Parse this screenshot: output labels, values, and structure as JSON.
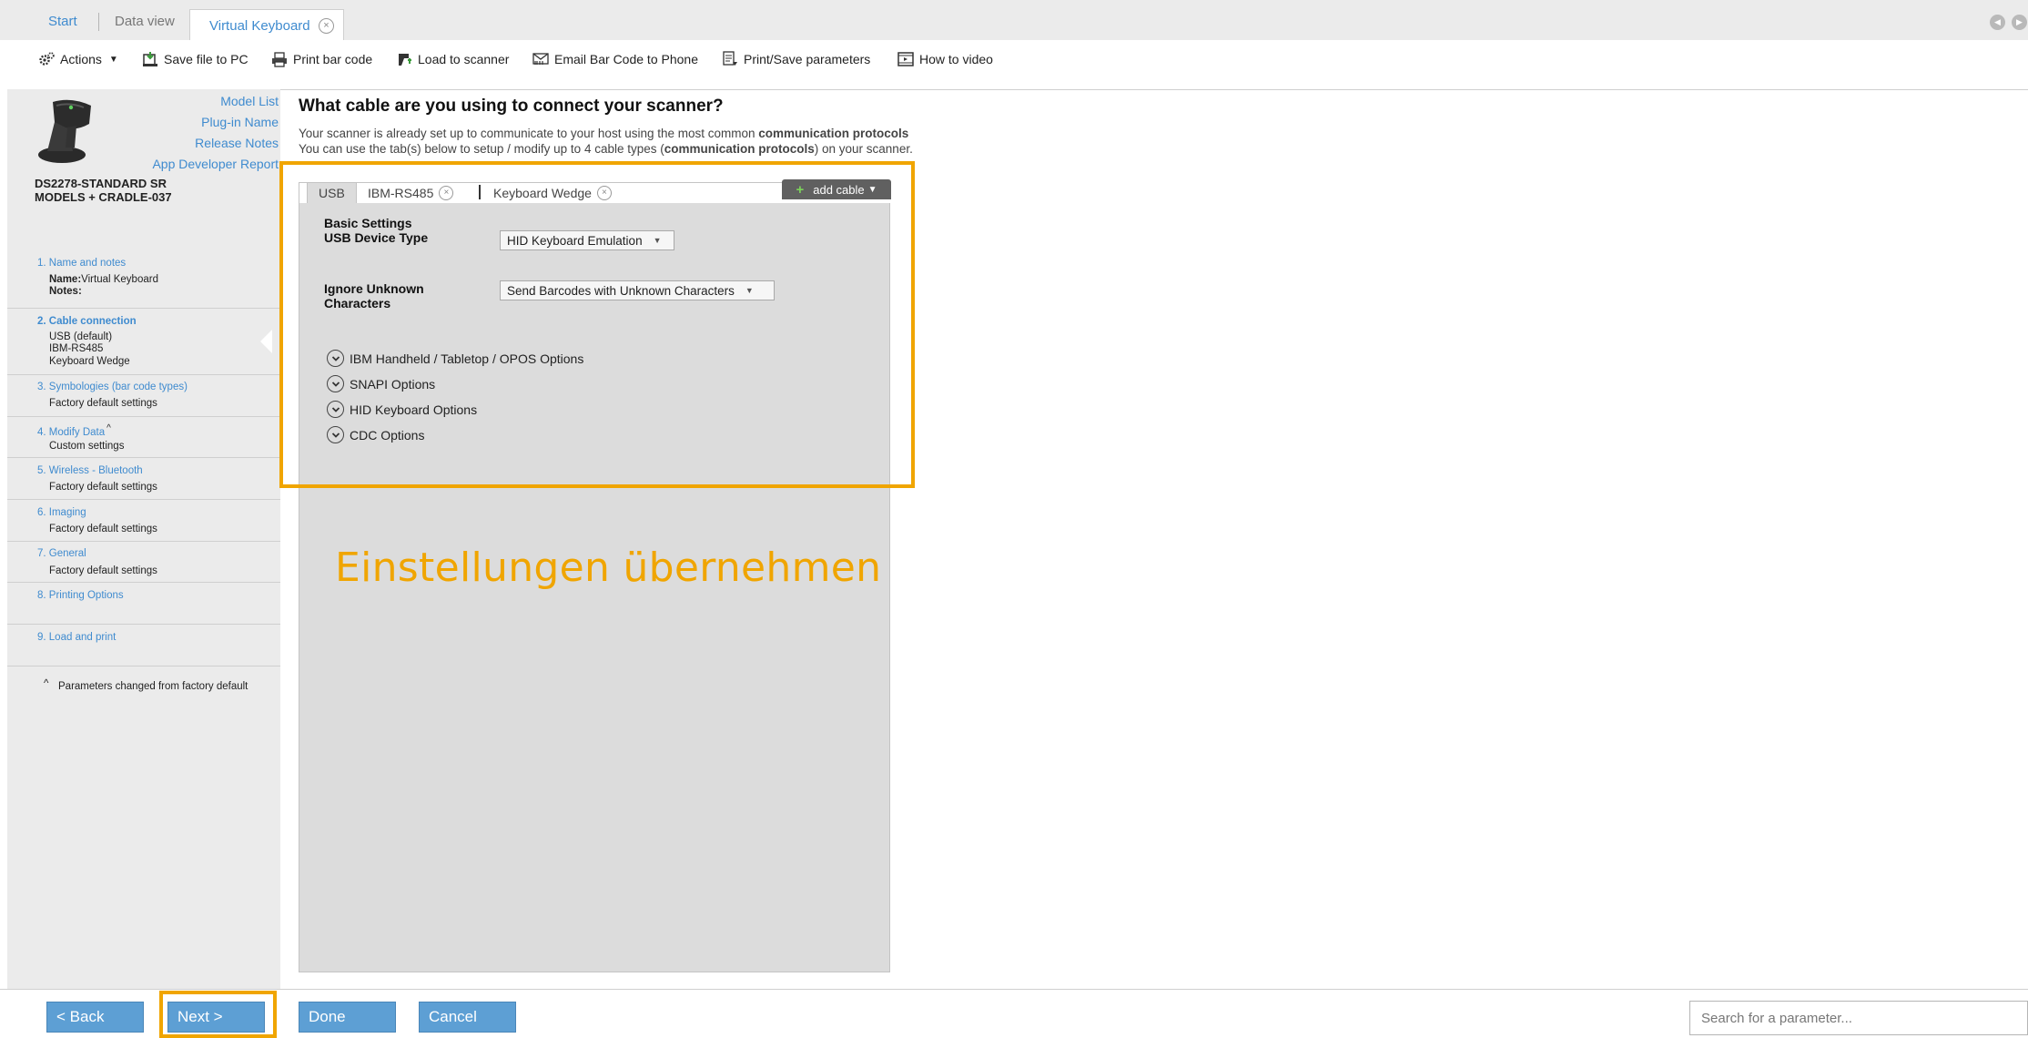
{
  "top_tabs": {
    "start": "Start",
    "data_view": "Data view",
    "active": "Virtual Keyboard",
    "close_glyph": "×"
  },
  "toolbar": {
    "actions": "Actions",
    "save_file": "Save file to PC",
    "print_barcode": "Print bar code",
    "load_scanner": "Load to scanner",
    "email_barcode": "Email Bar Code to Phone",
    "print_save_params": "Print/Save parameters",
    "how_to_video": "How to video"
  },
  "left": {
    "links": {
      "model_list": "Model List",
      "plugin_name": "Plug-in Name",
      "release_notes": "Release Notes",
      "app_dev_report": "App Developer Report"
    },
    "model_line1": "DS2278-STANDARD SR",
    "model_line2": "MODELS + CRADLE-037",
    "steps": [
      {
        "title": "1.  Name and notes",
        "sub": [
          "Virtual Keyboard"
        ],
        "name_label": "Name:",
        "notes_label": "Notes:"
      },
      {
        "title": "2.  Cable connection",
        "sub": [
          "USB (default)",
          "IBM-RS485",
          "Keyboard Wedge"
        ]
      },
      {
        "title": "3.  Symbologies (bar code types)",
        "sub": [
          "Factory default settings"
        ]
      },
      {
        "title": "4.  Modify Data",
        "marker": "^",
        "sub": [
          "Custom settings"
        ]
      },
      {
        "title": "5.  Wireless - Bluetooth",
        "sub": [
          "Factory default settings"
        ]
      },
      {
        "title": "6.  Imaging",
        "sub": [
          "Factory default settings"
        ]
      },
      {
        "title": "7.  General",
        "sub": [
          "Factory default settings"
        ]
      },
      {
        "title": "8.  Printing Options",
        "sub": []
      },
      {
        "title": "9.  Load and print",
        "sub": []
      }
    ],
    "footnote_marker": "^",
    "footnote": "Parameters changed from factory default"
  },
  "main": {
    "question": "What cable are you using to connect your scanner?",
    "intro_line1_a": "Your scanner is already set up to communicate to your host using the most common ",
    "intro_line1_b": "communication protocols",
    "intro_line2_a": "You can use the tab(s) below to setup / modify up to 4 cable types (",
    "intro_line2_b": "communication protocols",
    "intro_line2_c": ") on your scanner.",
    "cable_tabs": [
      "USB",
      "IBM-RS485",
      "Keyboard Wedge"
    ],
    "add_cable": "add cable",
    "basic_settings": "Basic Settings",
    "usb_device_type_label": "USB Device Type",
    "usb_device_type_value": "HID Keyboard Emulation",
    "ignore_unknown_label_1": "Ignore Unknown",
    "ignore_unknown_label_2": "Characters",
    "ignore_unknown_value": "Send Barcodes with Unknown Characters",
    "expanders": [
      "IBM Handheld / Tabletop / OPOS Options",
      "SNAPI Options",
      "HID Keyboard Options",
      "CDC Options"
    ],
    "overlay_text": "Einstellungen übernehmen"
  },
  "bottom": {
    "back": "< Back",
    "next": "Next >",
    "done": "Done",
    "cancel": "Cancel",
    "search_placeholder": "Search for a parameter..."
  },
  "colors": {
    "link_blue": "#3f8bcf",
    "highlight_orange": "#f0a500",
    "button_blue": "#5d9fd4",
    "panel_gray": "#dcdcdc"
  },
  "icons": [
    "gears-icon",
    "save-file-icon",
    "printer-icon",
    "scanner-icon",
    "email-barcode-icon",
    "print-save-icon",
    "video-icon",
    "close-icon",
    "chevron-down-icon",
    "plus-icon"
  ]
}
